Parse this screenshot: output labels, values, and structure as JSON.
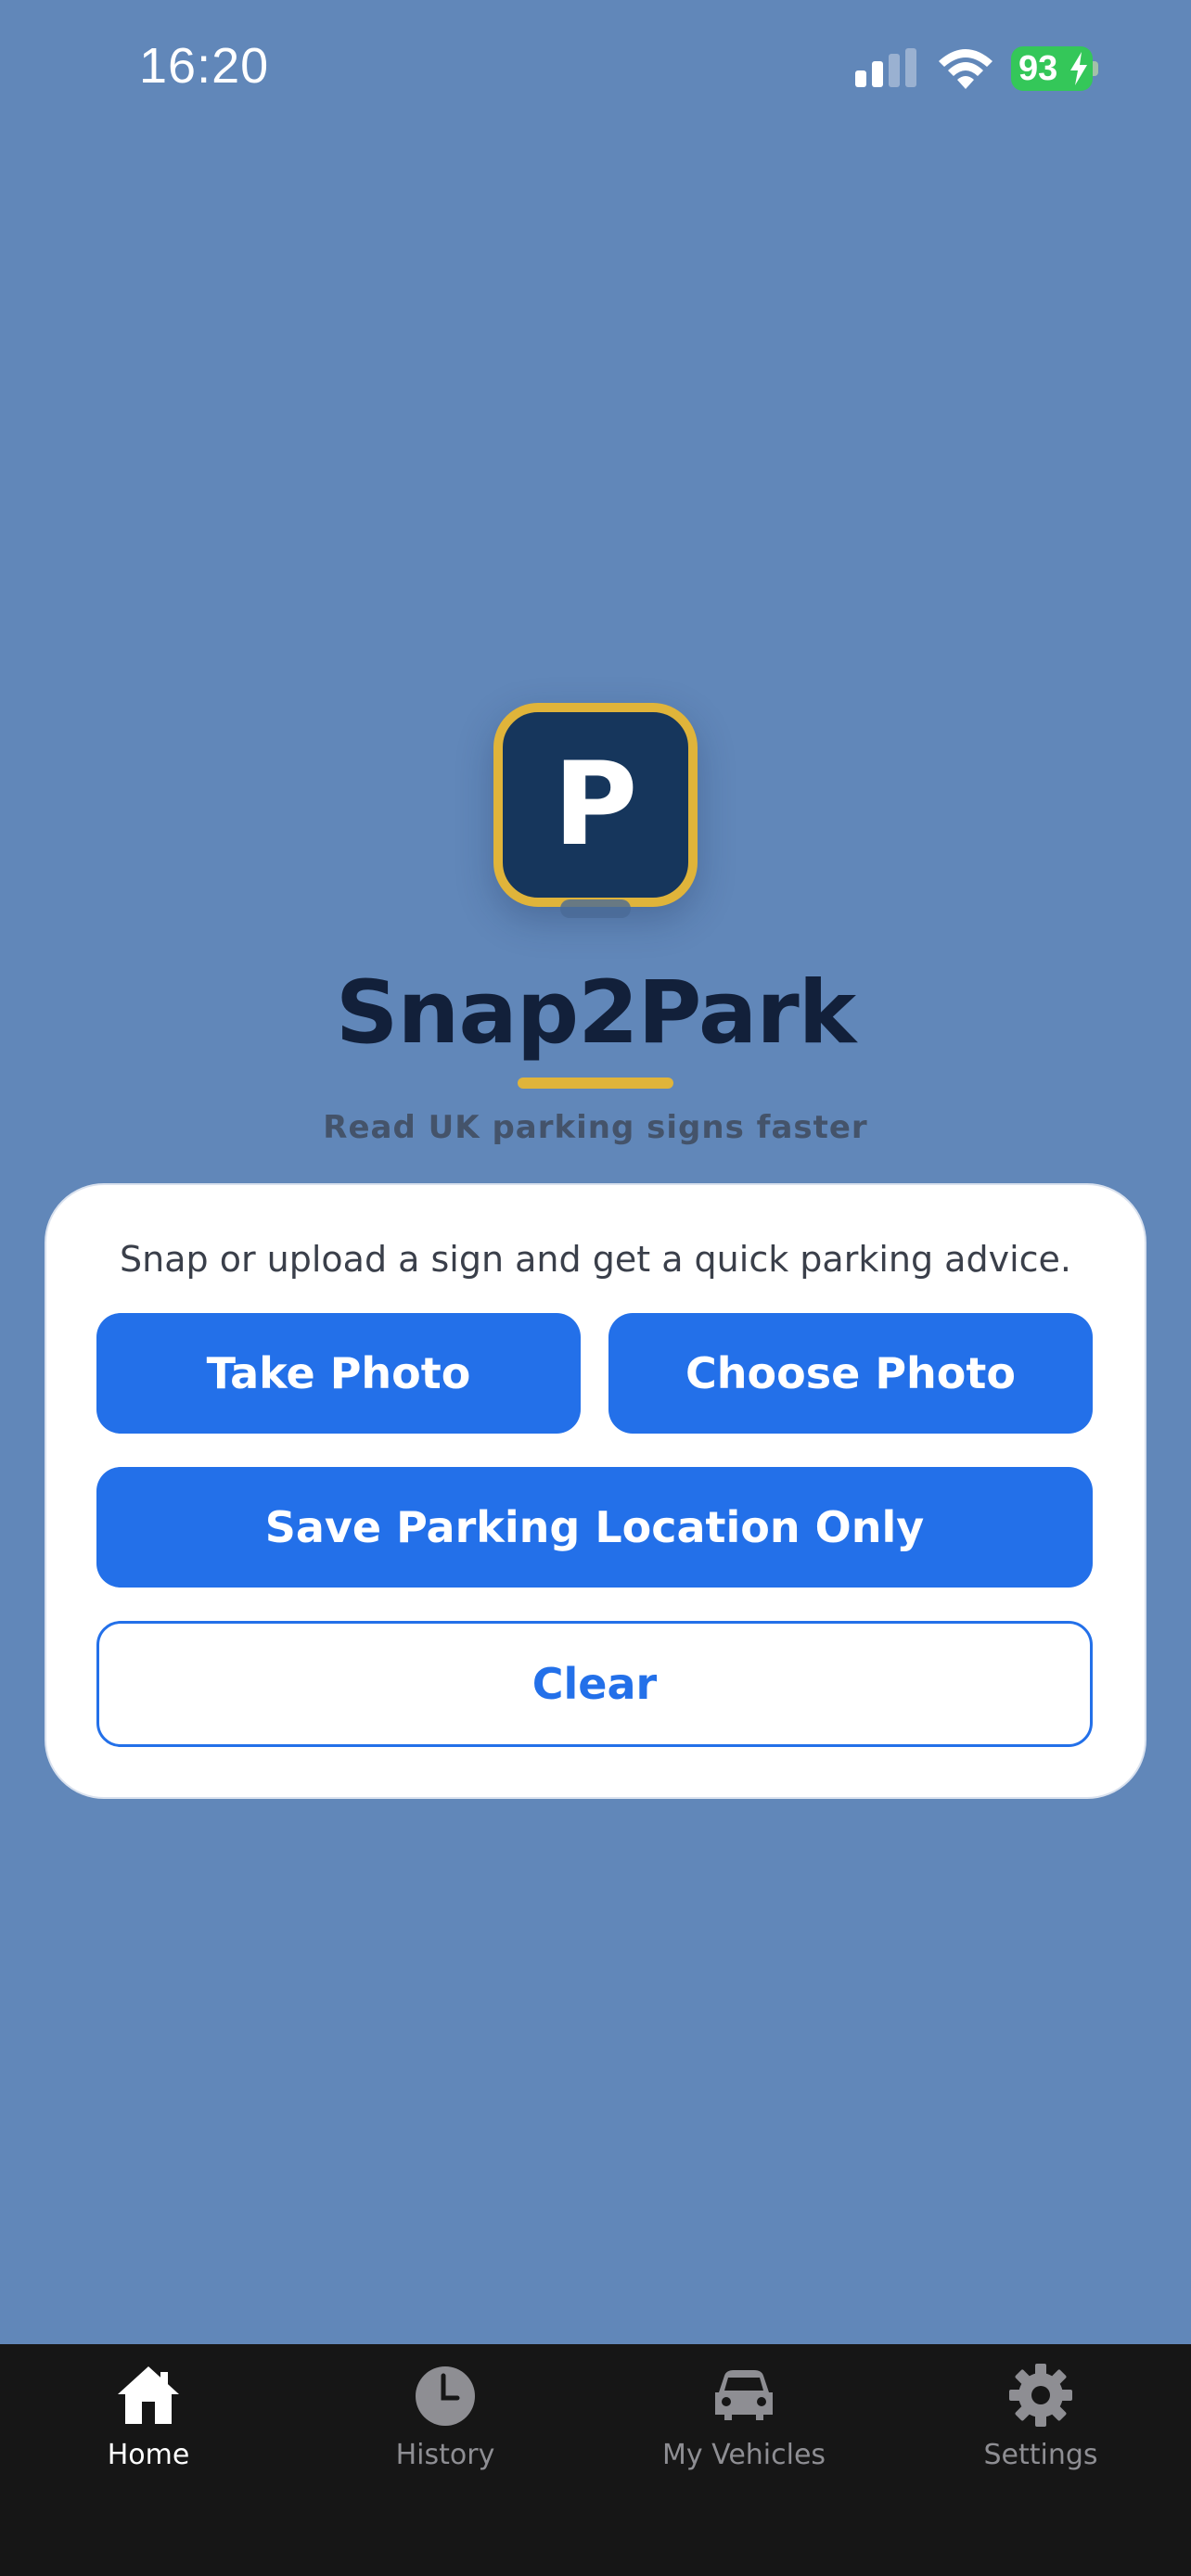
{
  "status_bar": {
    "time": "16:20",
    "battery": "93",
    "icons": [
      "signal-icon",
      "wifi-icon",
      "battery-charging-icon"
    ]
  },
  "app": {
    "icon_letter": "P",
    "title": "Snap2Park",
    "subtitle": "Read UK parking signs faster"
  },
  "card": {
    "description": "Snap or upload a sign and get a quick parking advice.",
    "take_photo_label": "Take Photo",
    "choose_photo_label": "Choose Photo",
    "save_location_label": "Save Parking Location Only",
    "clear_label": "Clear"
  },
  "tab_bar": {
    "items": [
      {
        "label": "Home",
        "icon": "home-icon",
        "active": true
      },
      {
        "label": "History",
        "icon": "clock-icon",
        "active": false
      },
      {
        "label": "My Vehicles",
        "icon": "car-icon",
        "active": false
      },
      {
        "label": "Settings",
        "icon": "gear-icon",
        "active": false
      }
    ]
  },
  "colors": {
    "background": "#6187b9",
    "accent_blue": "#2370e9",
    "icon_navy": "#16365c",
    "icon_gold": "#e0b43a",
    "battery_green": "#34c759",
    "tab_bar": "#161616"
  }
}
